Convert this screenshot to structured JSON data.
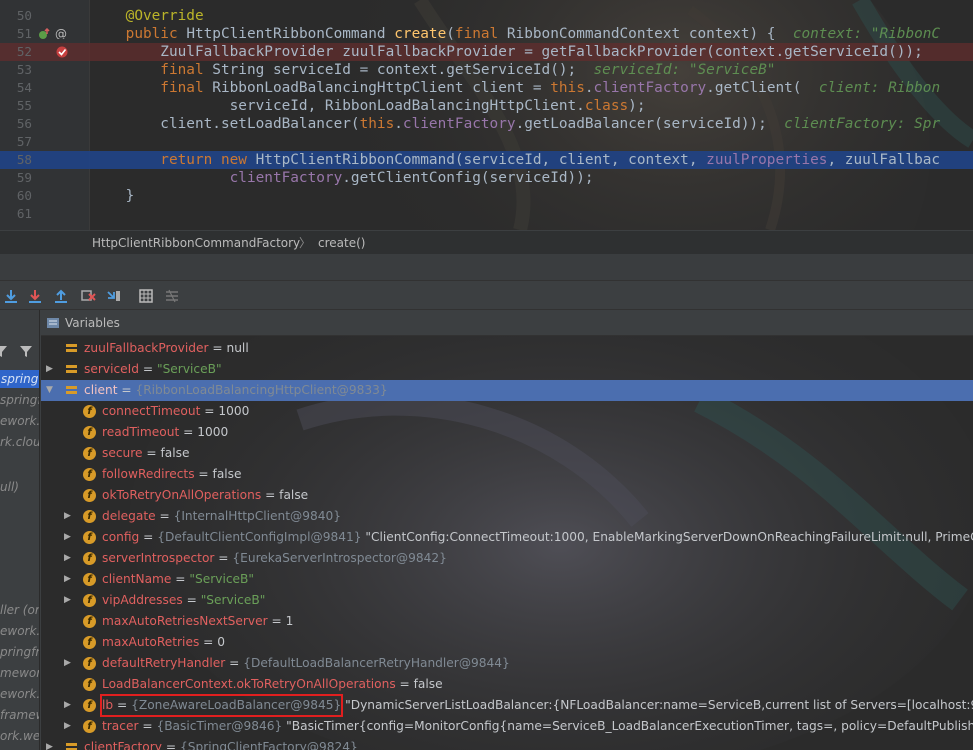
{
  "editor": {
    "lines": [
      {
        "num": "50",
        "tokens": [
          [
            "ann",
            "    @Override"
          ]
        ]
      },
      {
        "num": "51",
        "tokens": [
          [
            "kw",
            "    public "
          ],
          [
            "",
            "HttpClientRibbonCommand "
          ],
          [
            "fn",
            "create"
          ],
          [
            "",
            "("
          ],
          [
            "kw",
            "final "
          ],
          [
            "",
            "RibbonCommandContext context) {  "
          ],
          [
            "hint",
            "context: \"RibbonC"
          ]
        ]
      },
      {
        "num": "52",
        "tokens": [
          [
            "",
            "        ZuulFallbackProvider zuulFallbackProvider = getFallbackProvider(context.getServiceId());"
          ]
        ]
      },
      {
        "num": "53",
        "tokens": [
          [
            "kw",
            "        final "
          ],
          [
            "",
            "String serviceId = context.getServiceId();  "
          ],
          [
            "hint",
            "serviceId: \"ServiceB\""
          ]
        ]
      },
      {
        "num": "54",
        "tokens": [
          [
            "kw",
            "        final "
          ],
          [
            "",
            "RibbonLoadBalancingHttpClient client = "
          ],
          [
            "kw",
            "this"
          ],
          [
            "",
            "."
          ],
          [
            "fld",
            "clientFactory"
          ],
          [
            "",
            ".getClient(  "
          ],
          [
            "hint",
            "client: Ribbon"
          ]
        ]
      },
      {
        "num": "55",
        "tokens": [
          [
            "",
            "                serviceId, RibbonLoadBalancingHttpClient."
          ],
          [
            "kw",
            "class"
          ],
          [
            "",
            ");"
          ]
        ]
      },
      {
        "num": "56",
        "tokens": [
          [
            "",
            "        client.setLoadBalancer("
          ],
          [
            "kw",
            "this"
          ],
          [
            "",
            "."
          ],
          [
            "fld",
            "clientFactory"
          ],
          [
            "",
            ".getLoadBalancer(serviceId));  "
          ],
          [
            "hint",
            "clientFactory: Spr"
          ]
        ]
      },
      {
        "num": "57",
        "tokens": [
          [
            "",
            ""
          ]
        ]
      },
      {
        "num": "58",
        "tokens": [
          [
            "kw",
            "        return new "
          ],
          [
            "",
            "HttpClientRibbonCommand(serviceId, client, context, "
          ],
          [
            "fld",
            "zuulProperties"
          ],
          [
            "",
            ", zuulFallbac"
          ]
        ]
      },
      {
        "num": "59",
        "tokens": [
          [
            "fld",
            "                clientFactory"
          ],
          [
            "",
            ".getClientConfig(serviceId));"
          ]
        ]
      },
      {
        "num": "60",
        "tokens": [
          [
            "",
            "    }"
          ]
        ]
      },
      {
        "num": "61",
        "tokens": [
          [
            "",
            ""
          ]
        ]
      }
    ]
  },
  "breadcrumbs": {
    "class_name": "HttpClientRibbonCommandFactory",
    "method_name": "create()",
    "separator": "〉"
  },
  "debugger": {
    "variables_title": "Variables",
    "frames": [
      "springf",
      "springf",
      "ework.cl",
      "rk.cloud.",
      "ull)",
      "ller (or",
      "ework.cl",
      "pringfra",
      "mework.",
      "ework.we",
      "framew",
      "ork.web.s"
    ],
    "variables": [
      {
        "depth": 0,
        "icon": "local",
        "expander": "",
        "name": "zuulFallbackProvider",
        "eq": " = ",
        "type": "",
        "value": "null",
        "value_style": "vval"
      },
      {
        "depth": 0,
        "icon": "local",
        "expander": "▶",
        "name": "serviceId",
        "eq": " = ",
        "type": "",
        "value": "\"ServiceB\"",
        "value_style": "vstr"
      },
      {
        "depth": 0,
        "icon": "local",
        "expander": "▼",
        "name": "client",
        "eq": " = ",
        "type": "{RibbonLoadBalancingHttpClient@9833}",
        "value": "",
        "value_style": "vval",
        "selected": true
      },
      {
        "depth": 1,
        "icon": "f",
        "expander": "",
        "name": "connectTimeout",
        "eq": " = ",
        "type": "",
        "value": "1000",
        "value_style": "vval"
      },
      {
        "depth": 1,
        "icon": "f",
        "expander": "",
        "name": "readTimeout",
        "eq": " = ",
        "type": "",
        "value": "1000",
        "value_style": "vval"
      },
      {
        "depth": 1,
        "icon": "f",
        "expander": "",
        "name": "secure",
        "eq": " = ",
        "type": "",
        "value": "false",
        "value_style": "vval"
      },
      {
        "depth": 1,
        "icon": "f",
        "expander": "",
        "name": "followRedirects",
        "eq": " = ",
        "type": "",
        "value": "false",
        "value_style": "vval"
      },
      {
        "depth": 1,
        "icon": "f",
        "expander": "",
        "name": "okToRetryOnAllOperations",
        "eq": " = ",
        "type": "",
        "value": "false",
        "value_style": "vval"
      },
      {
        "depth": 1,
        "icon": "f",
        "expander": "▶",
        "name": "delegate",
        "eq": " = ",
        "type": "{InternalHttpClient@9840}",
        "value": "",
        "value_style": "vval"
      },
      {
        "depth": 1,
        "icon": "f",
        "expander": "▶",
        "name": "config",
        "eq": " = ",
        "type": "{DefaultClientConfigImpl@9841}",
        "value": " \"ClientConfig:ConnectTimeout:1000, EnableMarkingServerDownOnReachingFailureLimit:null, PrimeConnection",
        "value_style": "vval"
      },
      {
        "depth": 1,
        "icon": "f",
        "expander": "▶",
        "name": "serverIntrospector",
        "eq": " = ",
        "type": "{EurekaServerIntrospector@9842}",
        "value": "",
        "value_style": "vval"
      },
      {
        "depth": 1,
        "icon": "f",
        "expander": "▶",
        "name": "clientName",
        "eq": " = ",
        "type": "",
        "value": "\"ServiceB\"",
        "value_style": "vstr"
      },
      {
        "depth": 1,
        "icon": "f",
        "expander": "▶",
        "name": "vipAddresses",
        "eq": " = ",
        "type": "",
        "value": "\"ServiceB\"",
        "value_style": "vstr"
      },
      {
        "depth": 1,
        "icon": "f",
        "expander": "",
        "name": "maxAutoRetriesNextServer",
        "eq": " = ",
        "type": "",
        "value": "1",
        "value_style": "vval"
      },
      {
        "depth": 1,
        "icon": "f",
        "expander": "",
        "name": "maxAutoRetries",
        "eq": " = ",
        "type": "",
        "value": "0",
        "value_style": "vval"
      },
      {
        "depth": 1,
        "icon": "f",
        "expander": "▶",
        "name": "defaultRetryHandler",
        "eq": " = ",
        "type": "{DefaultLoadBalancerRetryHandler@9844}",
        "value": "",
        "value_style": "vval"
      },
      {
        "depth": 1,
        "icon": "f",
        "expander": "",
        "name": "LoadBalancerContext.okToRetryOnAllOperations",
        "eq": " = ",
        "type": "",
        "value": "false",
        "value_style": "vval"
      },
      {
        "depth": 1,
        "icon": "f",
        "expander": "▶",
        "name": "lb",
        "eq": " = ",
        "type": "{ZoneAwareLoadBalancer@9845}",
        "value": " \"DynamicServerListLoadBalancer:{NFLoadBalancer:name=ServiceB,current list of Servers=[localhost:9090],Load b",
        "value_style": "vval",
        "highlighted": true
      },
      {
        "depth": 1,
        "icon": "f",
        "expander": "▶",
        "name": "tracer",
        "eq": " = ",
        "type": "{BasicTimer@9846}",
        "value": " \"BasicTimer{config=MonitorConfig{name=ServiceB_LoadBalancerExecutionTimer, tags=, policy=DefaultPublishingPolicy}, t",
        "value_style": "vval"
      },
      {
        "depth": 0,
        "icon": "local",
        "expander": "▶",
        "name": "clientFactory",
        "eq": " = ",
        "type": "{SpringClientFactory@9824}",
        "value": "",
        "value_style": "vval"
      }
    ]
  }
}
